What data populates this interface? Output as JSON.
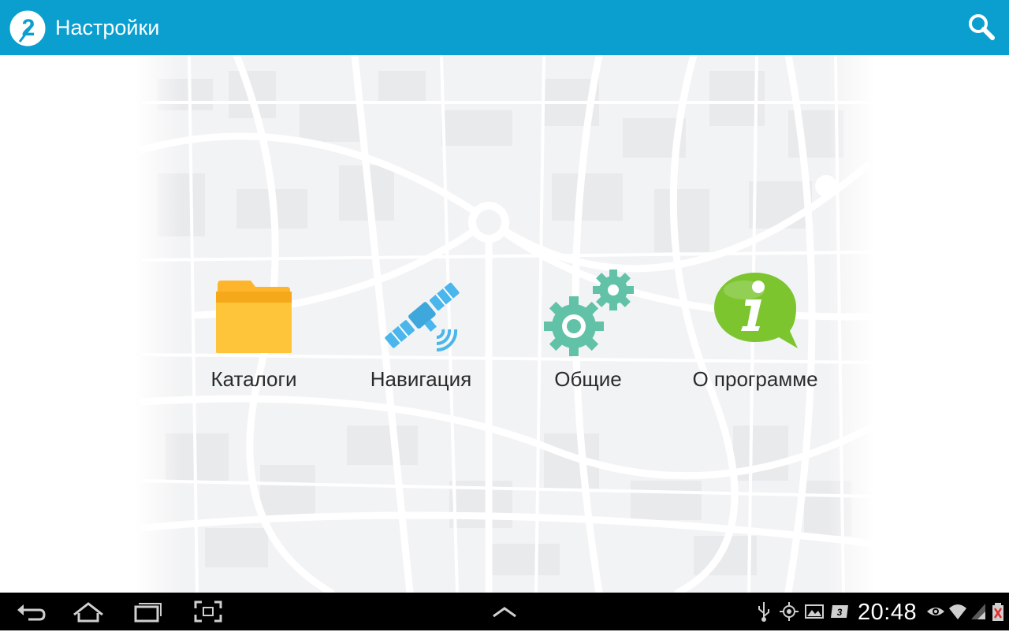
{
  "app": {
    "title": "Настройки",
    "logo_text": "2",
    "colors": {
      "action_bar": "#0a9fcf",
      "text": "#2b2b2b"
    }
  },
  "toolbar": {
    "search_icon": "search-icon"
  },
  "menu": {
    "items": [
      {
        "label": "Каталоги",
        "icon": "folder-icon",
        "color": "#ffb52b"
      },
      {
        "label": "Навигация",
        "icon": "satellite-icon",
        "color": "#47b4ea"
      },
      {
        "label": "Общие",
        "icon": "gears-icon",
        "color": "#5fbfa7"
      },
      {
        "label": "О программе",
        "icon": "info-bubble-icon",
        "color": "#7cc52f"
      }
    ]
  },
  "system_bar": {
    "time": "20:48",
    "nav_icons": [
      "back-icon",
      "home-icon",
      "recent-apps-icon",
      "screenshot-icon",
      "menu-up-icon"
    ],
    "status_icons": [
      "usb-icon",
      "gps-icon",
      "gallery-icon",
      "3g-icon",
      "eye-icon",
      "wifi-icon",
      "signal-icon",
      "battery-icon"
    ]
  }
}
